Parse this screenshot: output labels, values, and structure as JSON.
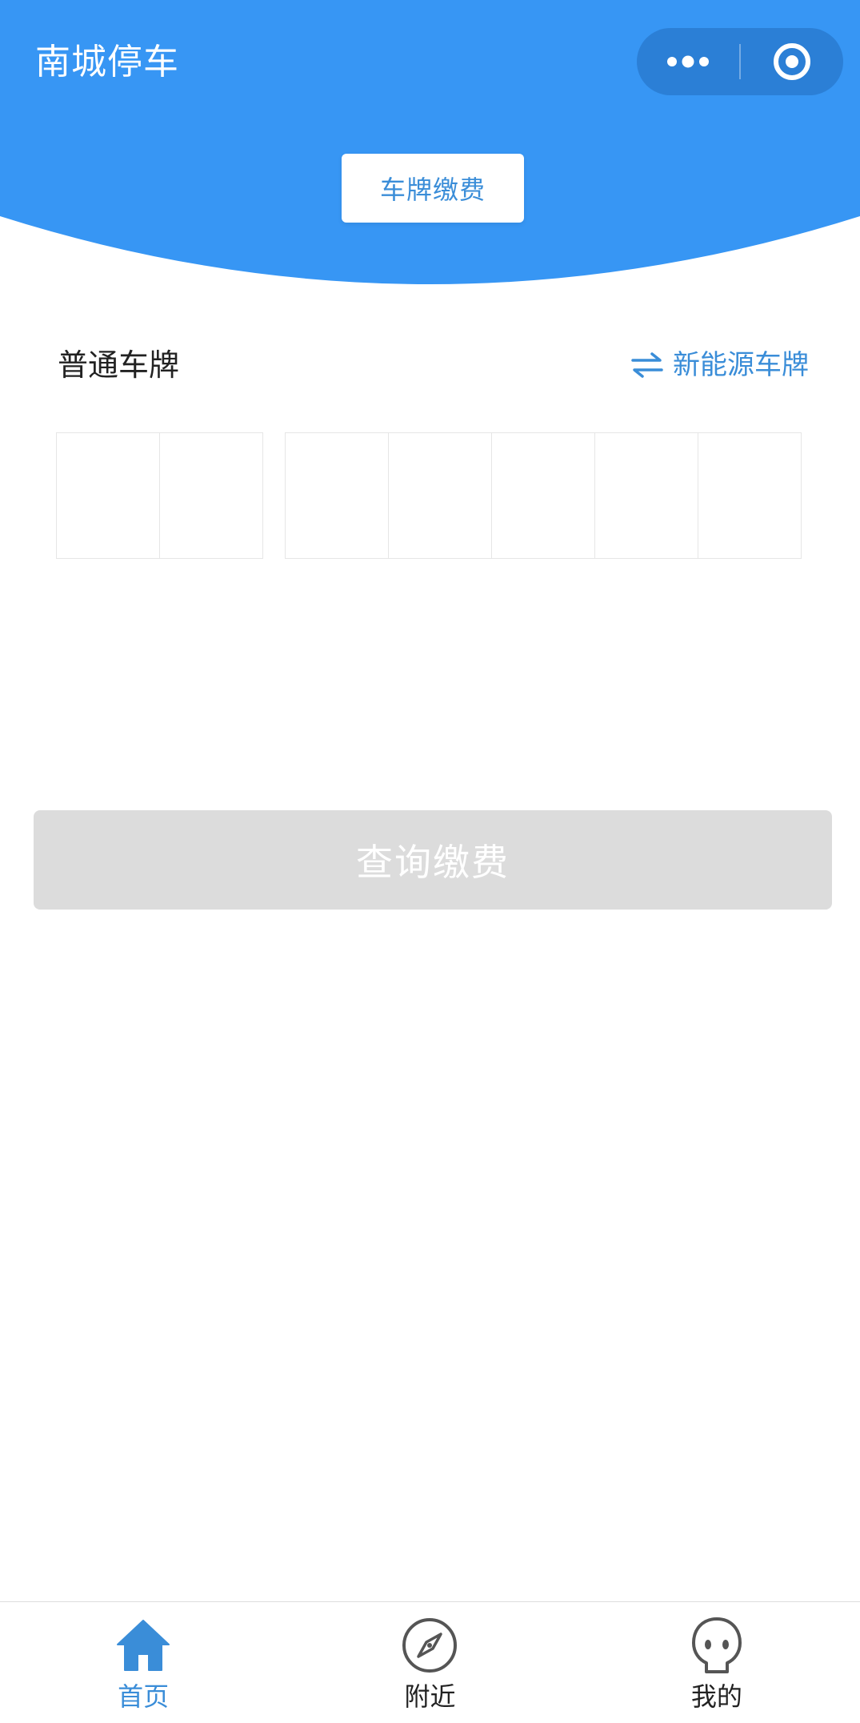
{
  "header": {
    "title": "南城停车",
    "capsule": {
      "more_icon": "more-dots-icon",
      "close_icon": "target-circle-icon"
    },
    "tab_label": "车牌缴费",
    "color": "#3796f4"
  },
  "plate": {
    "type_label": "普通车牌",
    "switch_label": "新能源车牌",
    "switch_icon": "swap-arrows-icon",
    "group1": [
      "",
      ""
    ],
    "group2": [
      "",
      "",
      "",
      "",
      ""
    ]
  },
  "query_button": {
    "label": "查询缴费",
    "color": "#dcdcdc"
  },
  "tabbar": {
    "items": [
      {
        "label": "首页",
        "icon": "home-icon",
        "active": true
      },
      {
        "label": "附近",
        "icon": "compass-icon",
        "active": false
      },
      {
        "label": "我的",
        "icon": "user-face-icon",
        "active": false
      }
    ],
    "active_color": "#3a8dd8"
  }
}
